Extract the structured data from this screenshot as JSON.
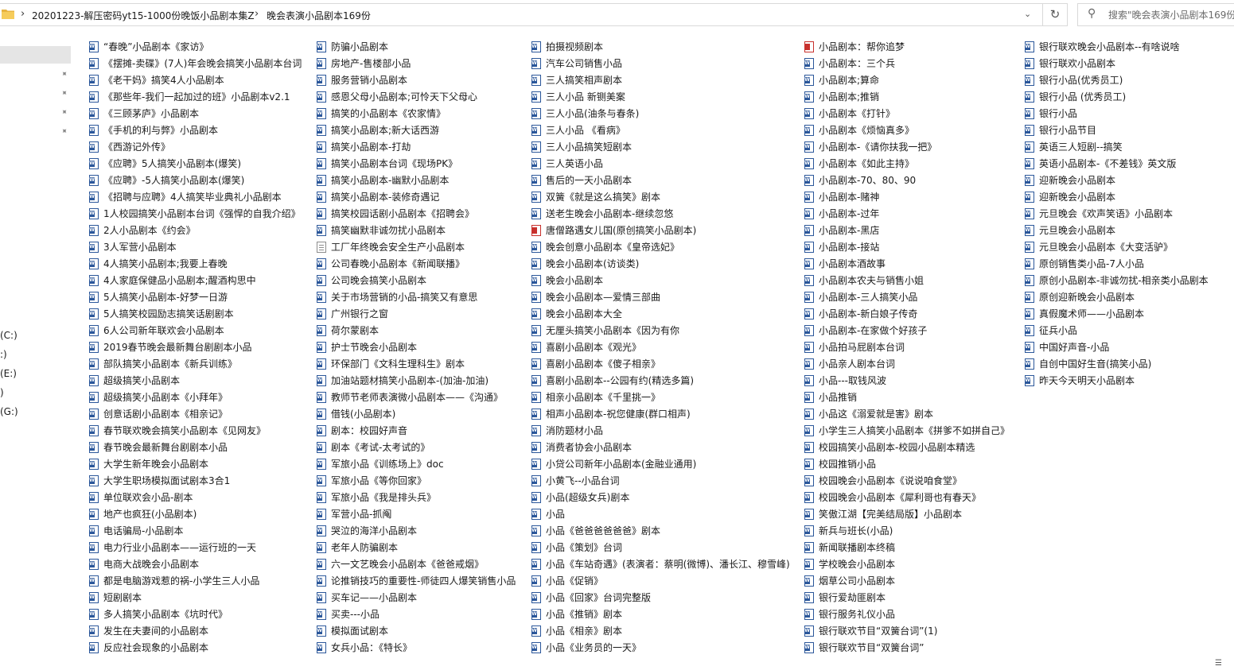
{
  "address": {
    "crumbs": [
      "20201223-解压密码yt15-1000份晚饭小品剧本集Z",
      "晚会表演小品剧本169份"
    ],
    "separator": "›",
    "dropdown_glyph": "⌄",
    "refresh_glyph": "↻"
  },
  "search": {
    "placeholder": "搜索\"晚会表演小品剧本169份\"",
    "icon_glyph": "⚲"
  },
  "nav": {
    "drives": [
      "(C:)",
      ":)",
      "(E:)",
      ")",
      "(G:)"
    ],
    "pin_glyph": "📌"
  },
  "status": {
    "view_glyph": "☰"
  },
  "columns": [
    [
      {
        "name": "“春晚”小品剧本《家访》",
        "type": "word"
      },
      {
        "name": "《摆摊-卖碟》(7人)年会晚会搞笑小品剧本台词",
        "type": "word"
      },
      {
        "name": "《老干妈》搞笑4人小品剧本",
        "type": "word"
      },
      {
        "name": "《那些年-我们一起加过的班》小品剧本v2.1",
        "type": "word"
      },
      {
        "name": "《三顾茅庐》小品剧本",
        "type": "word"
      },
      {
        "name": "《手机的利与弊》小品剧本",
        "type": "word"
      },
      {
        "name": "《西游记外传》",
        "type": "word"
      },
      {
        "name": "《应聘》5人搞笑小品剧本(爆笑)",
        "type": "word"
      },
      {
        "name": "《应聘》-5人搞笑小品剧本(爆笑)",
        "type": "word"
      },
      {
        "name": "《招聘与应聘》4人搞笑毕业典礼小品剧本",
        "type": "word"
      },
      {
        "name": "1人校园搞笑小品剧本台词《强悍的自我介绍》",
        "type": "word"
      },
      {
        "name": "2人小品剧本《约会》",
        "type": "word"
      },
      {
        "name": "3人军营小品剧本",
        "type": "word"
      },
      {
        "name": "4人搞笑小品剧本;我要上春晚",
        "type": "word"
      },
      {
        "name": "4人家庭保健品小品剧本;醒酒构思中",
        "type": "word"
      },
      {
        "name": "5人搞笑小品剧本-好梦一日游",
        "type": "word"
      },
      {
        "name": "5人搞笑校园励志搞笑话剧剧本",
        "type": "word"
      },
      {
        "name": "6人公司新年联欢会小品剧本",
        "type": "word"
      },
      {
        "name": "2019春节晚会最新舞台剧剧本小品",
        "type": "word"
      },
      {
        "name": "部队搞笑小品剧本《新兵训练》",
        "type": "word"
      },
      {
        "name": "超级搞笑小品剧本",
        "type": "word"
      },
      {
        "name": "超级搞笑小品剧本《小拜年》",
        "type": "word"
      },
      {
        "name": "创意话剧小品剧本《相亲记》",
        "type": "word"
      },
      {
        "name": "春节联欢晚会搞笑小品剧本《见网友》",
        "type": "word"
      },
      {
        "name": "春节晚会最新舞台剧剧本小品",
        "type": "word"
      },
      {
        "name": "大学生新年晚会小品剧本",
        "type": "word"
      },
      {
        "name": "大学生职场模拟面试剧本3合1",
        "type": "word"
      },
      {
        "name": "单位联欢会小品-剧本",
        "type": "word"
      },
      {
        "name": "地产也疯狂(小品剧本)",
        "type": "word"
      },
      {
        "name": "电话骗局-小品剧本",
        "type": "word"
      },
      {
        "name": "电力行业小品剧本——运行班的一天",
        "type": "word"
      },
      {
        "name": "电商大战晚会小品剧本",
        "type": "word"
      },
      {
        "name": "都是电脑游戏惹的祸-小学生三人小品",
        "type": "word"
      },
      {
        "name": "短剧剧本",
        "type": "word"
      },
      {
        "name": "多人搞笑小品剧本《坑时代》",
        "type": "word"
      },
      {
        "name": "发生在夫妻间的小品剧本",
        "type": "word"
      },
      {
        "name": "反应社会现象的小品剧本",
        "type": "word"
      }
    ],
    [
      {
        "name": "防骗小品剧本",
        "type": "word"
      },
      {
        "name": "房地产-售楼部小品",
        "type": "word"
      },
      {
        "name": "服务营销小品剧本",
        "type": "word"
      },
      {
        "name": "感恩父母小品剧本;可怜天下父母心",
        "type": "word"
      },
      {
        "name": "搞笑的小品剧本《农家情》",
        "type": "word"
      },
      {
        "name": "搞笑小品剧本;新大话西游",
        "type": "word"
      },
      {
        "name": "搞笑小品剧本-打劫",
        "type": "word"
      },
      {
        "name": "搞笑小品剧本台词《现场PK》",
        "type": "word"
      },
      {
        "name": "搞笑小品剧本-幽默小品剧本",
        "type": "word"
      },
      {
        "name": "搞笑小品剧本-装修奇遇记",
        "type": "word"
      },
      {
        "name": "搞笑校园话剧小品剧本《招聘会》",
        "type": "word"
      },
      {
        "name": "搞笑幽默非诚勿扰小品剧本",
        "type": "word"
      },
      {
        "name": "工厂年终晚会安全生产小品剧本",
        "type": "txt"
      },
      {
        "name": "公司春晚小品剧本《新闻联播》",
        "type": "word"
      },
      {
        "name": "公司晚会搞笑小品剧本",
        "type": "word"
      },
      {
        "name": "关于市场营销的小品-搞笑又有意思",
        "type": "word"
      },
      {
        "name": "广州银行之窗",
        "type": "word"
      },
      {
        "name": "荷尔蒙剧本",
        "type": "word"
      },
      {
        "name": "护士节晚会小品剧本",
        "type": "word"
      },
      {
        "name": "环保部门《文科生理科生》剧本",
        "type": "word"
      },
      {
        "name": "加油站题材搞笑小品剧本-(加油-加油)",
        "type": "word"
      },
      {
        "name": "教师节老师表演微小品剧本——《沟通》",
        "type": "word"
      },
      {
        "name": "借钱(小品剧本)",
        "type": "word"
      },
      {
        "name": "剧本：校园好声音",
        "type": "word"
      },
      {
        "name": "剧本《考试-太考试的》",
        "type": "word"
      },
      {
        "name": "军旅小品《训练场上》doc",
        "type": "word"
      },
      {
        "name": "军旅小品《等你回家》",
        "type": "word"
      },
      {
        "name": "军旅小品《我是排头兵》",
        "type": "word"
      },
      {
        "name": "军营小品-抓阄",
        "type": "word"
      },
      {
        "name": "哭泣的海洋小品剧本",
        "type": "word"
      },
      {
        "name": "老年人防骗剧本",
        "type": "word"
      },
      {
        "name": "六一文艺晚会小品剧本《爸爸戒烟》",
        "type": "word"
      },
      {
        "name": "论推销技巧的重要性-师徒四人爆笑销售小品",
        "type": "word"
      },
      {
        "name": "买车记——小品剧本",
        "type": "word"
      },
      {
        "name": "买卖---小品",
        "type": "word"
      },
      {
        "name": "模拟面试剧本",
        "type": "word"
      },
      {
        "name": "女兵小品：《特长》",
        "type": "word"
      }
    ],
    [
      {
        "name": "拍摄视频剧本",
        "type": "word"
      },
      {
        "name": "汽车公司销售小品",
        "type": "word"
      },
      {
        "name": "三人搞笑相声剧本",
        "type": "word"
      },
      {
        "name": "三人小品 新铡美案",
        "type": "word"
      },
      {
        "name": "三人小品(油条与春条)",
        "type": "word"
      },
      {
        "name": "三人小品 《看病》",
        "type": "word"
      },
      {
        "name": "三人小品搞笑短剧本",
        "type": "word"
      },
      {
        "name": "三人英语小品",
        "type": "word"
      },
      {
        "name": "售后的一天小品剧本",
        "type": "word"
      },
      {
        "name": "双簧《就是这么搞笑》剧本",
        "type": "word"
      },
      {
        "name": "送老生晚会小品剧本-继续忽悠",
        "type": "word"
      },
      {
        "name": "唐僧路遇女儿国(原创搞笑小品剧本)",
        "type": "pdf"
      },
      {
        "name": "晚会创意小品剧本《皇帝选妃》",
        "type": "word"
      },
      {
        "name": "晚会小品剧本(访谈类)",
        "type": "word"
      },
      {
        "name": "晚会小品剧本",
        "type": "word"
      },
      {
        "name": "晚会小品剧本—爱情三部曲",
        "type": "word"
      },
      {
        "name": "晚会小品剧本大全",
        "type": "word"
      },
      {
        "name": "无厘头搞笑小品剧本《因为有你",
        "type": "word"
      },
      {
        "name": "喜剧小品剧本《观光》",
        "type": "word"
      },
      {
        "name": "喜剧小品剧本《傻子相亲》",
        "type": "word"
      },
      {
        "name": "喜剧小品剧本--公园有约(精选多篇)",
        "type": "word"
      },
      {
        "name": "相亲小品剧本《千里挑一》",
        "type": "word"
      },
      {
        "name": "相声小品剧本-祝您健康(群口相声)",
        "type": "word"
      },
      {
        "name": "消防题材小品",
        "type": "word"
      },
      {
        "name": "消费者协会小品剧本",
        "type": "word"
      },
      {
        "name": "小贷公司新年小品剧本(金融业通用)",
        "type": "word"
      },
      {
        "name": "小黄飞--小品台词",
        "type": "word"
      },
      {
        "name": "小品(超级女兵)剧本",
        "type": "word"
      },
      {
        "name": "小品",
        "type": "word"
      },
      {
        "name": "小品《爸爸爸爸爸爸》剧本",
        "type": "word"
      },
      {
        "name": "小品《策划》台词",
        "type": "word"
      },
      {
        "name": "小品《车站奇遇》(表演者：蔡明(微博)、潘长江、穆雪峰)",
        "type": "word"
      },
      {
        "name": "小品《促销》",
        "type": "word"
      },
      {
        "name": "小品《回家》台词完整版",
        "type": "word"
      },
      {
        "name": "小品《推销》剧本",
        "type": "word"
      },
      {
        "name": "小品《相亲》剧本",
        "type": "word"
      },
      {
        "name": "小品《业务员的一天》",
        "type": "word"
      }
    ],
    [
      {
        "name": "小品剧本：帮你追梦",
        "type": "pdf"
      },
      {
        "name": "小品剧本：三个兵",
        "type": "word"
      },
      {
        "name": "小品剧本;算命",
        "type": "word"
      },
      {
        "name": "小品剧本;推销",
        "type": "word"
      },
      {
        "name": "小品剧本《打针》",
        "type": "word"
      },
      {
        "name": "小品剧本《烦恼真多》",
        "type": "word"
      },
      {
        "name": "小品剧本-《请你扶我一把》",
        "type": "word"
      },
      {
        "name": "小品剧本《如此主持》",
        "type": "word"
      },
      {
        "name": "小品剧本-70、80、90",
        "type": "word"
      },
      {
        "name": "小品剧本-赌神",
        "type": "word"
      },
      {
        "name": "小品剧本-过年",
        "type": "word"
      },
      {
        "name": "小品剧本-黑店",
        "type": "word"
      },
      {
        "name": "小品剧本-接站",
        "type": "word"
      },
      {
        "name": "小品剧本酒故事",
        "type": "word"
      },
      {
        "name": "小品剧本农夫与销售小姐",
        "type": "word"
      },
      {
        "name": "小品剧本-三人搞笑小品",
        "type": "word"
      },
      {
        "name": "小品剧本-新白娘子传奇",
        "type": "word"
      },
      {
        "name": "小品剧本-在家做个好孩子",
        "type": "word"
      },
      {
        "name": "小品拍马屁剧本台词",
        "type": "word"
      },
      {
        "name": "小品亲人剧本台词",
        "type": "word"
      },
      {
        "name": "小品---取钱风波",
        "type": "word"
      },
      {
        "name": "小品推销",
        "type": "word"
      },
      {
        "name": "小品这《溺爱就是害》剧本",
        "type": "word"
      },
      {
        "name": "小学生三人搞笑小品剧本《拼爹不如拼自己》",
        "type": "word"
      },
      {
        "name": "校园搞笑小品剧本-校园小品剧本精选",
        "type": "word"
      },
      {
        "name": "校园推销小品",
        "type": "word"
      },
      {
        "name": "校园晚会小品剧本《说说咱食堂》",
        "type": "word"
      },
      {
        "name": "校园晚会小品剧本《犀利哥也有春天》",
        "type": "word"
      },
      {
        "name": "笑傲江湖【完美结局版】小品剧本",
        "type": "word"
      },
      {
        "name": "新兵与班长(小品)",
        "type": "word"
      },
      {
        "name": "新闻联播剧本终稿",
        "type": "word"
      },
      {
        "name": "学校晚会小品剧本",
        "type": "word"
      },
      {
        "name": "烟草公司小品剧本",
        "type": "word"
      },
      {
        "name": "银行爱劫匪剧本",
        "type": "word"
      },
      {
        "name": "银行服务礼仪小品",
        "type": "word"
      },
      {
        "name": "银行联欢节目“双簧台词”(1)",
        "type": "word"
      },
      {
        "name": "银行联欢节目“双簧台词”",
        "type": "word"
      }
    ],
    [
      {
        "name": "银行联欢晚会小品剧本--有啥说啥",
        "type": "word"
      },
      {
        "name": "银行联欢小品剧本",
        "type": "word"
      },
      {
        "name": "银行小品(优秀员工)",
        "type": "word"
      },
      {
        "name": "银行小品 (优秀员工)",
        "type": "word"
      },
      {
        "name": "银行小品",
        "type": "word"
      },
      {
        "name": "银行小品节目",
        "type": "word"
      },
      {
        "name": "英语三人短剧--搞笑",
        "type": "word"
      },
      {
        "name": "英语小品剧本-《不差钱》英文版",
        "type": "word"
      },
      {
        "name": "迎新晚会小品剧本",
        "type": "word"
      },
      {
        "name": "迎新晚会小品剧本",
        "type": "word"
      },
      {
        "name": "元旦晚会《欢声笑语》小品剧本",
        "type": "word"
      },
      {
        "name": "元旦晚会小品剧本",
        "type": "word"
      },
      {
        "name": "元旦晚会小品剧本《大变活驴》",
        "type": "word"
      },
      {
        "name": "原创销售类小品-7人小品",
        "type": "word"
      },
      {
        "name": "原创小品剧本-非诚勿扰-相亲类小品剧本",
        "type": "word"
      },
      {
        "name": "原创迎新晚会小品剧本",
        "type": "word"
      },
      {
        "name": "真假魔术师——小品剧本",
        "type": "word"
      },
      {
        "name": "征兵小品",
        "type": "word"
      },
      {
        "name": "中国好声音-小品",
        "type": "word"
      },
      {
        "name": "自创中国好生音(搞笑小品)",
        "type": "word"
      },
      {
        "name": "昨天今天明天小品剧本",
        "type": "word"
      }
    ]
  ]
}
